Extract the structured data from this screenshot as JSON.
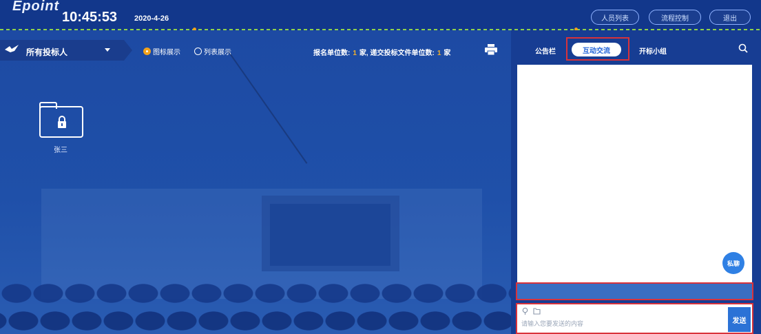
{
  "header": {
    "logo": "Epoint",
    "time": "10:45:53",
    "date": "2020-4-26",
    "buttons": [
      {
        "label": "人员列表"
      },
      {
        "label": "流程控制"
      },
      {
        "label": "退出"
      }
    ]
  },
  "toolbar": {
    "bidder_select": "所有投标人",
    "view_modes": [
      {
        "label": "图标展示",
        "selected": true
      },
      {
        "label": "列表展示",
        "selected": false
      }
    ],
    "stats": {
      "registered_label": "报名单位数:",
      "registered_count": "1",
      "registered_unit": "家,",
      "submitted_label": "递交投标文件单位数:",
      "submitted_count": "1",
      "submitted_unit": "家"
    }
  },
  "bidders": [
    {
      "name": "张三",
      "locked": true
    }
  ],
  "right_panel": {
    "tabs": [
      {
        "label": "公告栏"
      },
      {
        "label": "互动交流",
        "active": true
      },
      {
        "label": "开标小组"
      }
    ],
    "private_button": "私聊",
    "input_placeholder": "请输入您要发送的内容",
    "send_button": "发送"
  },
  "colors": {
    "accent": "#2163d8",
    "highlight": "#d9323a",
    "badge": "#f2a21b",
    "topbar": "#12378b"
  }
}
